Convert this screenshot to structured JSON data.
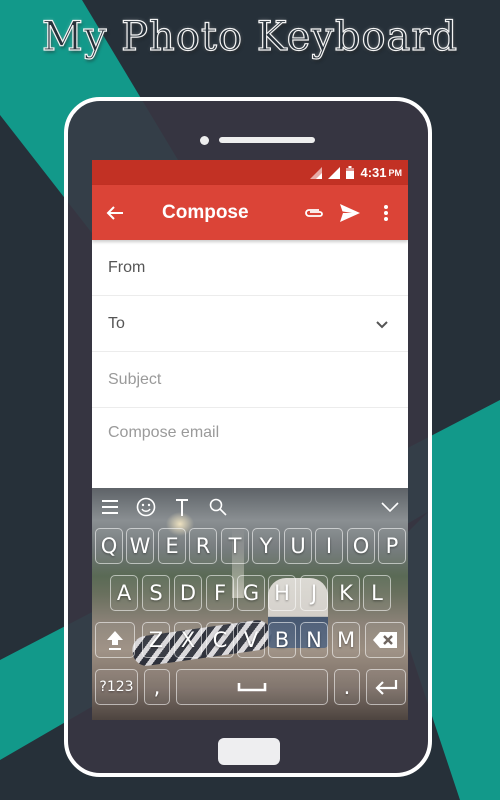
{
  "promo": {
    "title": "My Photo Keyboard",
    "colors": {
      "background": "#263039",
      "accent": "#12998a",
      "phone_body": "#373642",
      "phone_border": "#ffffff"
    }
  },
  "status_bar": {
    "time": "4:31",
    "ampm": "PM",
    "icons": [
      "signal-icon",
      "signal-icon",
      "battery-icon"
    ],
    "color": "#c23124"
  },
  "app_bar": {
    "title": "Compose",
    "back_icon": "arrow-left-icon",
    "actions": [
      "paperclip-icon",
      "send-icon",
      "more-vert-icon"
    ],
    "color": "#db4437"
  },
  "form": {
    "from_label": "From",
    "to_label": "To",
    "subject_placeholder": "Subject",
    "body_placeholder": "Compose email"
  },
  "keyboard": {
    "toolbar": [
      "menu-icon",
      "emoji-icon",
      "text-style-icon",
      "search-icon",
      "collapse-chevron-icon"
    ],
    "row1": [
      "Q",
      "W",
      "E",
      "R",
      "T",
      "Y",
      "U",
      "I",
      "O",
      "P"
    ],
    "row2": [
      "A",
      "S",
      "D",
      "F",
      "G",
      "H",
      "J",
      "K",
      "L"
    ],
    "row3": [
      "Z",
      "X",
      "C",
      "V",
      "B",
      "N",
      "M"
    ],
    "shift_icon": "shift-icon",
    "backspace_icon": "backspace-icon",
    "symbols_label": "?123",
    "comma_label": ",",
    "space_icon": "space-icon",
    "period_label": ".",
    "enter_icon": "enter-icon"
  }
}
